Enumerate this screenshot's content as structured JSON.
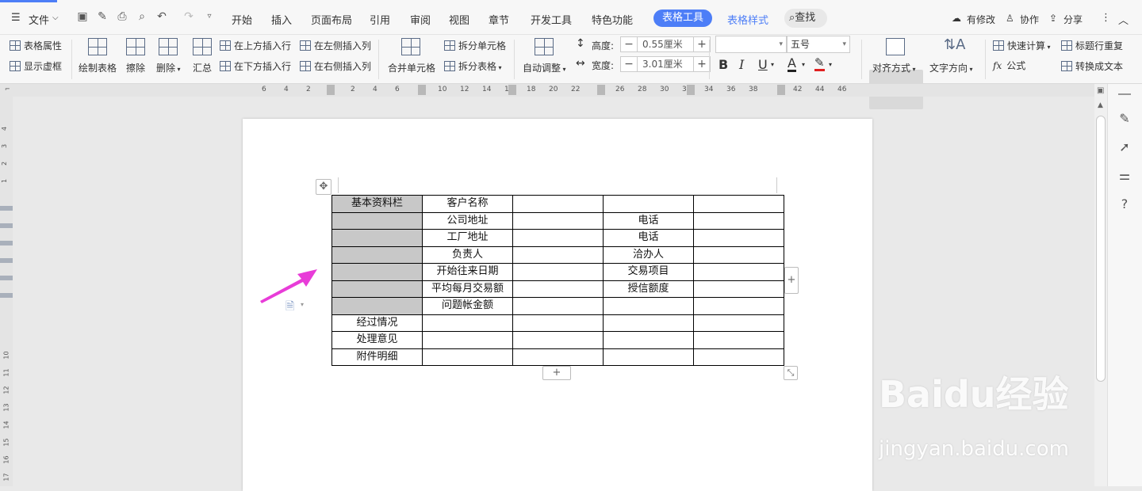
{
  "menubar": {
    "file": "文件",
    "tabs": [
      "开始",
      "插入",
      "页面布局",
      "引用",
      "审阅",
      "视图",
      "章节",
      "开发工具",
      "特色功能"
    ],
    "table_tools": "表格工具",
    "table_style": "表格样式",
    "search": "查找",
    "right": {
      "modified": "有修改",
      "collab": "协作",
      "share": "分享"
    }
  },
  "ribbon": {
    "table_props": "表格属性",
    "show_grid": "显示虚框",
    "draw_table": "绘制表格",
    "erase": "擦除",
    "delete": "删除",
    "summary": "汇总",
    "insert_above": "在上方插入行",
    "insert_below": "在下方插入行",
    "insert_left": "在左侧插入列",
    "insert_right": "在右侧插入列",
    "merge_cells": "合并单元格",
    "split_cells": "拆分单元格",
    "split_table": "拆分表格",
    "auto_adjust": "自动调整",
    "height_label": "高度:",
    "height_value": "0.55厘米",
    "width_label": "宽度:",
    "width_value": "3.01厘米",
    "font_name": "",
    "font_size": "五号",
    "bold": "B",
    "italic": "I",
    "underline": "U",
    "font_color": "A",
    "align": "对齐方式",
    "text_dir": "文字方向",
    "quick_calc": "快速计算",
    "header_repeat": "标题行重复",
    "formula": "公式",
    "convert_text": "转换成文本"
  },
  "ruler": {
    "labels": [
      "6",
      "4",
      "2",
      "2",
      "4",
      "6",
      "10",
      "12",
      "14",
      "16",
      "18",
      "20",
      "22",
      "26",
      "28",
      "30",
      "32",
      "34",
      "36",
      "38",
      "42",
      "44",
      "46"
    ],
    "vlabels": [
      "4",
      "3",
      "2",
      "1",
      "10",
      "11",
      "12",
      "13",
      "14",
      "15",
      "16",
      "17"
    ]
  },
  "table": {
    "rows": [
      [
        "基本资料栏",
        "客户名称",
        "",
        "",
        ""
      ],
      [
        "",
        "公司地址",
        "",
        "电话",
        ""
      ],
      [
        "",
        "工厂地址",
        "",
        "电话",
        ""
      ],
      [
        "",
        "负责人",
        "",
        "洽办人",
        ""
      ],
      [
        "",
        "开始往来日期",
        "",
        "交易项目",
        ""
      ],
      [
        "",
        "平均每月交易额",
        "",
        "授信额度",
        ""
      ],
      [
        "",
        "问题帐金额",
        "",
        "",
        ""
      ],
      [
        "经过情况",
        "",
        "",
        "",
        ""
      ],
      [
        "处理意见",
        "",
        "",
        "",
        ""
      ],
      [
        "附件明细",
        "",
        "",
        "",
        ""
      ]
    ],
    "gray_rows": 7
  },
  "watermark": {
    "brand": "Baidu经验",
    "url": "jingyan.baidu.com"
  },
  "colors": {
    "accent": "#4d7ef7",
    "arrow": "#e83cd8",
    "gray_cell": "#c8c8c8"
  }
}
